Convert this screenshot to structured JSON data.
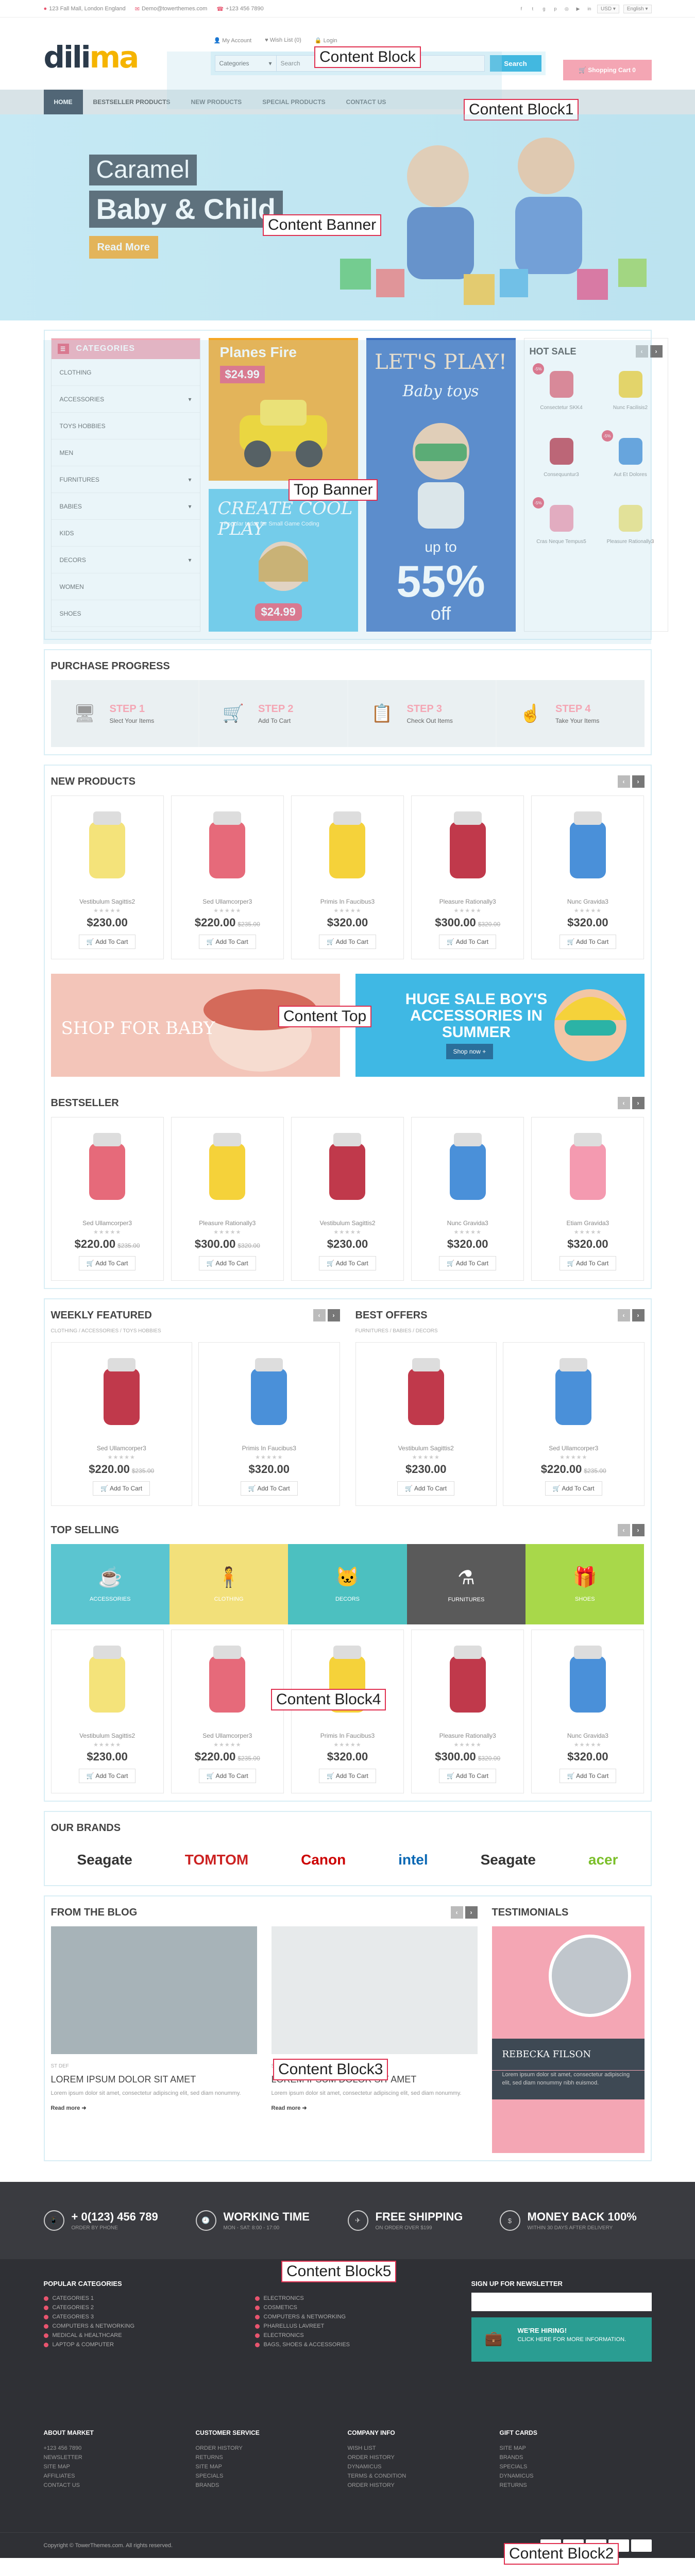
{
  "topbar": {
    "address": "123 Fall Mall, London England",
    "email": "Demo@towerthemes.com",
    "phone": "+123 456 7890",
    "currency": "USD",
    "language": "English"
  },
  "header": {
    "logo_a": "dili",
    "logo_b": "ma",
    "my_account": "My Account",
    "wishlist": "Wish List (0)",
    "login": "Login",
    "category_label": "Categories",
    "search_placeholder": "Search",
    "search_button": "Search",
    "cart": "Shopping Cart 0"
  },
  "nav": {
    "items": [
      "Home",
      "Bestseller Products",
      "New Products",
      "Special Products",
      "Contact Us"
    ]
  },
  "banner": {
    "line1": "Caramel",
    "line2": "Baby & Child",
    "cta": "Read More"
  },
  "categories": {
    "title": "Categories",
    "items": [
      "Clothing",
      "Accessories",
      "Toys Hobbies",
      "Men",
      "Furnitures",
      "Babies",
      "Kids",
      "Decors",
      "Women",
      "Shoes"
    ]
  },
  "promo": {
    "planes_title": "Planes Fire",
    "planes_price": "$24.99",
    "create_title": "CREATE COOL PLAY",
    "create_sub": "Popular today for Small Game Coding",
    "create_price": "$24.99",
    "lets_play": "LET'S PLAY!",
    "baby_toys": "Baby toys",
    "up_to": "up to",
    "percent": "55%",
    "off": "off"
  },
  "hot_sale": {
    "title": "Hot Sale",
    "items": [
      {
        "name": "Consectetur SKK4",
        "tag": "-5%"
      },
      {
        "name": "Nunc Facilisis2",
        "tag": ""
      },
      {
        "name": "Consequuntur3",
        "tag": ""
      },
      {
        "name": "Aut Et Dolores",
        "tag": "-5%"
      },
      {
        "name": "Cras Neque Tempus5",
        "tag": "-5%"
      },
      {
        "name": "Pleasure Rationally3",
        "tag": ""
      }
    ]
  },
  "progress": {
    "title": "Purchase Progress",
    "steps": [
      {
        "num": "STEP 1",
        "text": "Slect Your Items"
      },
      {
        "num": "STEP 2",
        "text": "Add To Cart"
      },
      {
        "num": "STEP 3",
        "text": "Check Out Items"
      },
      {
        "num": "STEP 4",
        "text": "Take Your Items"
      }
    ]
  },
  "new_products": {
    "title": "New Products",
    "add_label": "Add To Cart",
    "items": [
      {
        "name": "Vestibulum Sagittis2",
        "price": "$230.00",
        "old": ""
      },
      {
        "name": "Sed Ullamcorper3",
        "price": "$220.00",
        "old": "$235.00"
      },
      {
        "name": "Primis In Faucibus3",
        "price": "$320.00",
        "old": ""
      },
      {
        "name": "Pleasure Rationally3",
        "price": "$300.00",
        "old": "$320.00"
      },
      {
        "name": "Nunc Gravida3",
        "price": "$320.00",
        "old": ""
      }
    ]
  },
  "content_top": {
    "left": "SHOP FOR BABY",
    "right": "HUGE SALE BOY'S ACCESSORIES IN SUMMER",
    "button": "Shop now +"
  },
  "bestseller": {
    "title": "Bestseller",
    "add_label": "Add To Cart",
    "items": [
      {
        "name": "Sed Ullamcorper3",
        "price": "$220.00",
        "old": "$235.00"
      },
      {
        "name": "Pleasure Rationally3",
        "price": "$300.00",
        "old": "$320.00"
      },
      {
        "name": "Vestibulum Sagittis2",
        "price": "$230.00",
        "old": ""
      },
      {
        "name": "Nunc Gravida3",
        "price": "$320.00",
        "old": ""
      },
      {
        "name": "Etiam Gravida3",
        "price": "$320.00",
        "old": ""
      }
    ]
  },
  "weekly": {
    "title": "Weekly Featured",
    "breadcrumb": "CLOTHING / ACCESSORIES / TOYS HOBBIES",
    "add_label": "Add To Cart",
    "items": [
      {
        "name": "Sed Ullamcorper3",
        "price": "$220.00",
        "old": "$235.00"
      },
      {
        "name": "Primis In Faucibus3",
        "price": "$320.00",
        "old": ""
      }
    ]
  },
  "offers": {
    "title": "Best Offers",
    "breadcrumb": "FURNITURES / BABIES / DECORS",
    "add_label": "Add To Cart",
    "items": [
      {
        "name": "Vestibulum Sagittis2",
        "price": "$230.00",
        "old": ""
      },
      {
        "name": "Sed Ullamcorper3",
        "price": "$220.00",
        "old": "$235.00"
      }
    ]
  },
  "top_selling": {
    "title": "Top Selling",
    "add_label": "Add To Cart",
    "tiles": [
      {
        "label": "Accessories",
        "color": "#5bc5d0"
      },
      {
        "label": "Clothing",
        "color": "#f2e07a"
      },
      {
        "label": "Decors",
        "color": "#4cc0c0"
      },
      {
        "label": "Furnitures",
        "color": "#5a5a5a"
      },
      {
        "label": "Shoes",
        "color": "#a8d84a"
      }
    ],
    "items": [
      {
        "name": "Vestibulum Sagittis2",
        "price": "$230.00",
        "old": ""
      },
      {
        "name": "Sed Ullamcorper3",
        "price": "$220.00",
        "old": "$235.00"
      },
      {
        "name": "Primis In Faucibus3",
        "price": "$320.00",
        "old": ""
      },
      {
        "name": "Pleasure Rationally3",
        "price": "$300.00",
        "old": "$320.00"
      },
      {
        "name": "Nunc Gravida3",
        "price": "$320.00",
        "old": ""
      }
    ]
  },
  "brands": {
    "title": "Our Brands",
    "items": [
      "Seagate",
      "TOMTOM",
      "Canon",
      "intel",
      "Seagate",
      "acer"
    ]
  },
  "blog": {
    "title": "From The Blog",
    "read_more": "Read more",
    "posts": [
      {
        "meta": "ST DEF",
        "title": "LOREM IPSUM DOLOR SIT AMET",
        "excerpt": "Lorem ipsum dolor sit amet, consectetur adipiscing elit, sed diam nonummy."
      },
      {
        "meta": "ST DEF / PLACE THEMES",
        "title": "LOREM IPSUM DOLOR SIT AMET",
        "excerpt": "Lorem ipsum dolor sit amet, consectetur adipiscing elit, sed diam nonummy."
      }
    ]
  },
  "testimonials": {
    "title": "Testimonials",
    "name": "Rebecka Filson",
    "quote": "Lorem ipsum dolor sit amet, consectetur adipiscing elit, sed diam nonummy nibh euismod."
  },
  "footer_features": [
    {
      "title": "+ 0(123) 456 789",
      "sub": "ORDER BY PHONE"
    },
    {
      "title": "WORKING TIME",
      "sub": "MON - SAT: 8:00 - 17:00"
    },
    {
      "title": "FREE SHIPPING",
      "sub": "ON ORDER OVER $199"
    },
    {
      "title": "MONEY BACK 100%",
      "sub": "WITHIN 30 DAYS AFTER DELIVERY"
    }
  ],
  "popular_cats": {
    "title": "Popular Categories",
    "left": [
      "CATEGORIES 1",
      "CATEGORIES 2",
      "CATEGORIES 3",
      "COMPUTERS & NETWORKING",
      "MEDICAL & HEALTHCARE",
      "LAPTOP & COMPUTER"
    ],
    "right": [
      "ELECTRONICS",
      "COSMETICS",
      "COMPUTERS & NETWORKING",
      "PHARELLUS LAVREET",
      "ELECTRONICS",
      "BAGS, SHOES & ACCESSORIES"
    ]
  },
  "newsletter": {
    "title": "Sign Up For Newsletter",
    "hiring": "WE'RE HIRING!",
    "hiring_sub": "CLICK HERE FOR MORE INFORMATION."
  },
  "footer_links": [
    {
      "title": "About Market",
      "items": [
        "+123 456 7890",
        "NEWSLETTER",
        "SITE MAP",
        "AFFILIATES",
        "CONTACT US"
      ]
    },
    {
      "title": "Customer Service",
      "items": [
        "ORDER HISTORY",
        "RETURNS",
        "SITE MAP",
        "SPECIALS",
        "BRANDS"
      ]
    },
    {
      "title": "Company Info",
      "items": [
        "WISH LIST",
        "ORDER HISTORY",
        "DYNAMICUS",
        "TERMS & CONDITION",
        "ORDER HISTORY"
      ]
    },
    {
      "title": "Gift Cards",
      "items": [
        "SITE MAP",
        "BRANDS",
        "SPECIALS",
        "DYNAMICUS",
        "RETURNS"
      ]
    }
  ],
  "copyright": "Copyright © TowerThemes.com. All rights reserved.",
  "labels": {
    "content_block": "Content Block",
    "content_block1": "Content Block1",
    "content_banner": "Content Banner",
    "top_banner": "Top Banner",
    "content_top": "Content Top",
    "content_block4": "Content Block4",
    "content_block3": "Content Block3",
    "content_block5": "Content Block5",
    "content_block2": "Content Block2"
  }
}
